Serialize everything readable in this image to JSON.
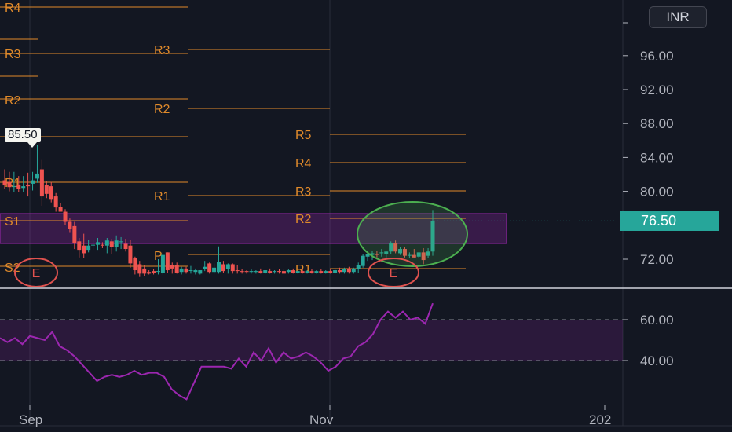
{
  "currency_label": "INR",
  "last_price_label": "76.50",
  "high_marker_label": "85.50",
  "colors": {
    "background": "#131722",
    "up": "#26a69a",
    "down": "#ef5350",
    "pivot": "#e08a2b",
    "zone": "#9c27b0",
    "rsi": "#9c27b0",
    "highlight_circle": "#4caf50",
    "event_circle": "#e0524f",
    "grid": "#2a2e39",
    "price_badge": "#26a69a"
  },
  "chart_data": [
    {
      "type": "candlestick",
      "panel": "price",
      "y_axis_ticks": [
        "96.00",
        "92.00",
        "88.00",
        "84.00",
        "80.00",
        "72.00"
      ],
      "x_axis_ticks": [
        "Sep",
        "Nov",
        "202"
      ],
      "ylim": [
        70.2,
        101.6
      ],
      "last_price": 76.5,
      "high_marker": 85.5,
      "candles": [
        {
          "o": 81.3,
          "h": 82.6,
          "l": 80.3,
          "c": 80.7
        },
        {
          "o": 81.1,
          "h": 82.3,
          "l": 80.0,
          "c": 80.5
        },
        {
          "o": 80.6,
          "h": 82.3,
          "l": 79.9,
          "c": 80.6
        },
        {
          "o": 80.8,
          "h": 81.8,
          "l": 79.9,
          "c": 80.3
        },
        {
          "o": 80.4,
          "h": 81.8,
          "l": 79.9,
          "c": 80.6
        },
        {
          "o": 80.8,
          "h": 82.2,
          "l": 79.4,
          "c": 80.6
        },
        {
          "o": 80.9,
          "h": 82.3,
          "l": 80.1,
          "c": 81.3
        },
        {
          "o": 81.5,
          "h": 85.5,
          "l": 81.0,
          "c": 82.1
        },
        {
          "o": 82.6,
          "h": 83.7,
          "l": 78.3,
          "c": 79.4
        },
        {
          "o": 80.8,
          "h": 81.2,
          "l": 79.2,
          "c": 79.7
        },
        {
          "o": 80.6,
          "h": 81.1,
          "l": 78.7,
          "c": 79.1
        },
        {
          "o": 79.4,
          "h": 79.8,
          "l": 77.6,
          "c": 78.1
        },
        {
          "o": 78.2,
          "h": 78.6,
          "l": 77.7,
          "c": 77.6
        },
        {
          "o": 77.6,
          "h": 77.9,
          "l": 76.0,
          "c": 76.4
        },
        {
          "o": 76.4,
          "h": 76.8,
          "l": 75.1,
          "c": 75.6
        },
        {
          "o": 75.9,
          "h": 76.4,
          "l": 73.2,
          "c": 73.9
        },
        {
          "o": 74.1,
          "h": 74.5,
          "l": 72.2,
          "c": 73.1
        },
        {
          "o": 73.6,
          "h": 75.0,
          "l": 72.1,
          "c": 72.7
        },
        {
          "o": 73.1,
          "h": 74.3,
          "l": 72.8,
          "c": 73.6
        },
        {
          "o": 73.7,
          "h": 74.3,
          "l": 73.1,
          "c": 73.7
        },
        {
          "o": 73.7,
          "h": 74.5,
          "l": 73.1,
          "c": 74.0
        },
        {
          "o": 73.7,
          "h": 74.0,
          "l": 73.3,
          "c": 73.6
        },
        {
          "o": 73.6,
          "h": 74.5,
          "l": 72.7,
          "c": 74.2
        },
        {
          "o": 74.1,
          "h": 74.4,
          "l": 72.6,
          "c": 73.4
        },
        {
          "o": 73.4,
          "h": 74.8,
          "l": 72.9,
          "c": 74.2
        },
        {
          "o": 74.0,
          "h": 74.6,
          "l": 73.2,
          "c": 74.1
        },
        {
          "o": 73.8,
          "h": 74.4,
          "l": 72.9,
          "c": 73.2
        },
        {
          "o": 73.6,
          "h": 74.3,
          "l": 71.0,
          "c": 71.5
        },
        {
          "o": 72.1,
          "h": 72.3,
          "l": 70.2,
          "c": 70.7
        },
        {
          "o": 71.4,
          "h": 71.8,
          "l": 69.9,
          "c": 70.3
        },
        {
          "o": 70.9,
          "h": 71.3,
          "l": 70.0,
          "c": 70.3
        },
        {
          "o": 70.5,
          "h": 70.7,
          "l": 70.2,
          "c": 70.3
        },
        {
          "o": 70.6,
          "h": 70.8,
          "l": 70.2,
          "c": 70.4
        },
        {
          "o": 70.6,
          "h": 72.0,
          "l": 70.2,
          "c": 70.6
        },
        {
          "o": 70.4,
          "h": 72.8,
          "l": 70.2,
          "c": 72.5
        },
        {
          "o": 72.8,
          "h": 72.8,
          "l": 70.4,
          "c": 70.7
        },
        {
          "o": 71.3,
          "h": 71.6,
          "l": 70.3,
          "c": 70.9
        },
        {
          "o": 71.3,
          "h": 71.6,
          "l": 70.3,
          "c": 70.4
        },
        {
          "o": 70.5,
          "h": 71.1,
          "l": 70.2,
          "c": 70.9
        },
        {
          "o": 70.9,
          "h": 71.1,
          "l": 70.3,
          "c": 70.5
        },
        {
          "o": 70.7,
          "h": 71.2,
          "l": 70.3,
          "c": 70.7
        },
        {
          "o": 70.5,
          "h": 70.9,
          "l": 70.2,
          "c": 70.7
        },
        {
          "o": 70.3,
          "h": 70.7,
          "l": 70.2,
          "c": 70.7
        },
        {
          "o": 70.8,
          "h": 71.8,
          "l": 70.6,
          "c": 71.1
        },
        {
          "o": 71.5,
          "h": 71.6,
          "l": 70.3,
          "c": 70.5
        },
        {
          "o": 70.5,
          "h": 71.5,
          "l": 70.3,
          "c": 71.0
        },
        {
          "o": 70.5,
          "h": 73.5,
          "l": 70.3,
          "c": 71.7
        },
        {
          "o": 71.4,
          "h": 71.8,
          "l": 70.4,
          "c": 70.6
        },
        {
          "o": 70.8,
          "h": 71.5,
          "l": 70.3,
          "c": 71.4
        },
        {
          "o": 71.4,
          "h": 71.5,
          "l": 70.3,
          "c": 70.6
        },
        {
          "o": 70.7,
          "h": 71.3,
          "l": 70.3,
          "c": 70.6
        },
        {
          "o": 70.6,
          "h": 70.8,
          "l": 70.3,
          "c": 70.5
        },
        {
          "o": 70.6,
          "h": 70.7,
          "l": 70.3,
          "c": 70.5
        },
        {
          "o": 70.5,
          "h": 70.8,
          "l": 70.3,
          "c": 70.6
        },
        {
          "o": 70.5,
          "h": 70.7,
          "l": 70.3,
          "c": 70.6
        },
        {
          "o": 70.6,
          "h": 70.9,
          "l": 70.3,
          "c": 70.4
        },
        {
          "o": 70.4,
          "h": 70.7,
          "l": 70.3,
          "c": 70.7
        },
        {
          "o": 70.6,
          "h": 70.9,
          "l": 70.3,
          "c": 70.4
        },
        {
          "o": 70.5,
          "h": 70.7,
          "l": 70.3,
          "c": 70.6
        },
        {
          "o": 70.6,
          "h": 70.8,
          "l": 70.3,
          "c": 70.5
        },
        {
          "o": 70.6,
          "h": 70.8,
          "l": 70.3,
          "c": 70.3
        },
        {
          "o": 70.5,
          "h": 70.8,
          "l": 70.3,
          "c": 70.7
        },
        {
          "o": 70.7,
          "h": 70.9,
          "l": 70.3,
          "c": 70.4
        },
        {
          "o": 70.4,
          "h": 70.7,
          "l": 70.3,
          "c": 70.6
        },
        {
          "o": 70.6,
          "h": 70.8,
          "l": 70.3,
          "c": 70.4
        },
        {
          "o": 70.4,
          "h": 70.7,
          "l": 70.3,
          "c": 70.6
        },
        {
          "o": 70.6,
          "h": 70.8,
          "l": 70.3,
          "c": 70.4
        },
        {
          "o": 70.4,
          "h": 70.7,
          "l": 70.3,
          "c": 70.6
        },
        {
          "o": 70.6,
          "h": 70.8,
          "l": 70.3,
          "c": 70.4
        },
        {
          "o": 70.4,
          "h": 70.7,
          "l": 70.3,
          "c": 70.6
        },
        {
          "o": 70.6,
          "h": 70.8,
          "l": 70.3,
          "c": 70.4
        },
        {
          "o": 70.4,
          "h": 70.8,
          "l": 70.3,
          "c": 70.7
        },
        {
          "o": 70.7,
          "h": 71.0,
          "l": 70.3,
          "c": 70.5
        },
        {
          "o": 70.5,
          "h": 71.0,
          "l": 70.3,
          "c": 70.8
        },
        {
          "o": 70.8,
          "h": 71.1,
          "l": 70.3,
          "c": 70.5
        },
        {
          "o": 70.5,
          "h": 71.0,
          "l": 70.3,
          "c": 70.9
        },
        {
          "o": 70.8,
          "h": 71.6,
          "l": 70.4,
          "c": 71.3
        },
        {
          "o": 71.2,
          "h": 72.6,
          "l": 71.0,
          "c": 72.4
        },
        {
          "o": 72.3,
          "h": 73.0,
          "l": 71.8,
          "c": 72.6
        },
        {
          "o": 72.5,
          "h": 73.0,
          "l": 71.9,
          "c": 72.7
        },
        {
          "o": 72.6,
          "h": 73.0,
          "l": 72.2,
          "c": 72.5
        },
        {
          "o": 72.7,
          "h": 73.2,
          "l": 72.3,
          "c": 72.8
        },
        {
          "o": 72.6,
          "h": 73.0,
          "l": 72.1,
          "c": 72.9
        },
        {
          "o": 72.9,
          "h": 74.1,
          "l": 72.6,
          "c": 73.9
        },
        {
          "o": 73.9,
          "h": 74.2,
          "l": 72.7,
          "c": 72.9
        },
        {
          "o": 72.7,
          "h": 73.4,
          "l": 72.5,
          "c": 73.2
        },
        {
          "o": 73.2,
          "h": 73.4,
          "l": 72.2,
          "c": 72.4
        },
        {
          "o": 72.4,
          "h": 72.8,
          "l": 72.1,
          "c": 72.5
        },
        {
          "o": 72.5,
          "h": 73.2,
          "l": 72.2,
          "c": 72.2
        },
        {
          "o": 72.3,
          "h": 72.8,
          "l": 72.1,
          "c": 72.8
        },
        {
          "o": 72.8,
          "h": 73.3,
          "l": 71.4,
          "c": 71.9
        },
        {
          "o": 72.4,
          "h": 73.3,
          "l": 72.1,
          "c": 72.9
        },
        {
          "o": 72.9,
          "h": 77.8,
          "l": 72.4,
          "c": 76.5
        }
      ]
    },
    {
      "type": "line",
      "panel": "rsi",
      "name": "",
      "y_axis_ticks": [
        "60.00",
        "40.00"
      ],
      "upper_band": 60,
      "lower_band": 40,
      "ylim": [
        27,
        73
      ],
      "values": [
        51,
        49,
        51,
        48,
        52,
        51,
        50,
        54,
        47,
        45,
        42,
        38,
        34,
        30,
        32,
        33,
        32,
        33,
        35,
        33,
        34,
        34,
        32,
        26,
        23,
        21,
        29,
        37,
        37,
        37,
        37,
        36,
        41,
        37,
        44,
        40,
        46,
        39,
        44,
        41,
        42,
        44,
        42,
        39,
        35,
        37,
        41,
        42,
        47,
        49,
        53,
        60,
        64,
        61,
        64,
        60,
        61,
        58,
        68
      ]
    }
  ],
  "pivot_labels": [
    "R4",
    "R3",
    "R2",
    "R1",
    "P",
    "S1",
    "S2",
    "R3",
    "R2",
    "R1",
    "P",
    "R5",
    "R4",
    "R3",
    "R2",
    "R1"
  ],
  "event_labels": [
    "E",
    "E"
  ]
}
